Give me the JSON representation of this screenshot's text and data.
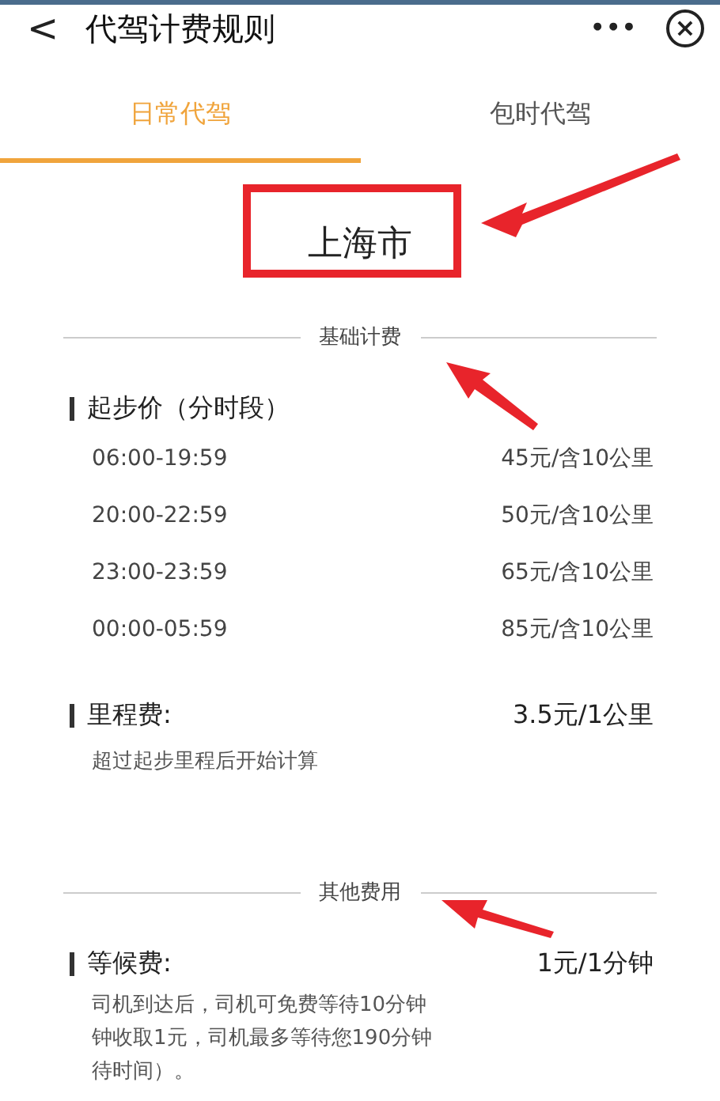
{
  "header": {
    "back": "<",
    "title": "代驾计费规则",
    "more": "•••",
    "close": "×"
  },
  "tabs": [
    {
      "label": "日常代驾",
      "selected": true
    },
    {
      "label": "包时代驾",
      "selected": false
    }
  ],
  "city": "上海市",
  "sections": [
    {
      "heading": "基础计费",
      "groups": [
        {
          "title": "起步价（分时段）",
          "rows": [
            {
              "time": "06:00-19:59",
              "price": "45元/含10公里"
            },
            {
              "time": "20:00-22:59",
              "price": "50元/含10公里"
            },
            {
              "time": "23:00-23:59",
              "price": "65元/含10公里"
            },
            {
              "time": "00:00-05:59",
              "price": "85元/含10公里"
            }
          ]
        },
        {
          "title": "里程费:",
          "value": "3.5元/1公里",
          "note_lines": [
            "超过起步里程后开始计算"
          ]
        }
      ]
    },
    {
      "heading": "其他费用",
      "groups": [
        {
          "title": "等候费:",
          "value": "1元/1分钟",
          "note_lines": [
            "司机到达后，司机可免费等待10分钟",
            "钟收取1元，司机最多等待您190分钟",
            "待时间）。"
          ]
        }
      ]
    }
  ]
}
